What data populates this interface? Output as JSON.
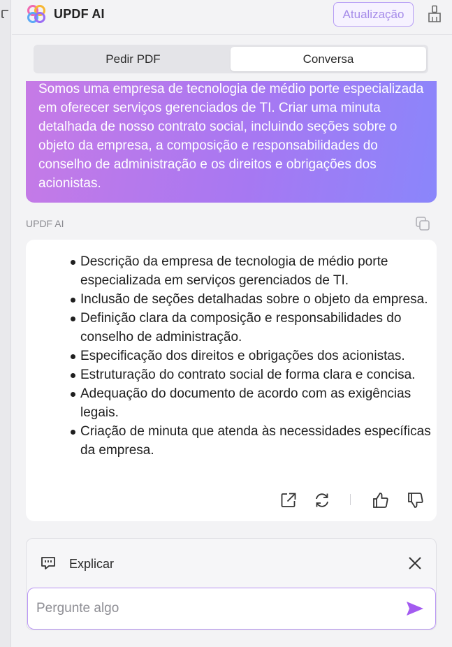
{
  "header": {
    "brand": "UPDF AI",
    "upgrade_label": "Atualização",
    "icons": {
      "logo": "updf-logo",
      "clear": "broom-icon"
    }
  },
  "tabs": [
    {
      "label": "Pedir PDF",
      "active": false
    },
    {
      "label": "Conversa",
      "active": true
    }
  ],
  "conversation": {
    "user_message": "Somos uma empresa de tecnologia de médio porte especializada em oferecer serviços gerenciados de TI. Criar uma minuta detalhada de nosso contrato social, incluindo seções sobre o objeto da empresa, a composição e responsabilidades do conselho de administração e os direitos e obrigações dos acionistas.",
    "ai_label": "UPDF AI",
    "ai_bullets": [
      "Descrição da empresa de tecnologia de médio porte especializada em serviços gerenciados de TI.",
      "Inclusão de seções detalhadas sobre o objeto da empresa.",
      "Definição clara da composição e responsabilidades do conselho de administração.",
      "Especificação dos direitos e obrigações dos acionistas.",
      "Estruturação do contrato social de forma clara e concisa.",
      "Adequação do documento de acordo com as exigências legais.",
      "Criação de minuta que atenda às necessidades específicas da empresa."
    ]
  },
  "composer": {
    "mode_label": "Explicar",
    "placeholder": "Pergunte algo"
  },
  "colors": {
    "accent": "#a778f2",
    "gradient_start": "#c67ae6",
    "gradient_end": "#8a86fb",
    "send": "#a35bf0"
  }
}
